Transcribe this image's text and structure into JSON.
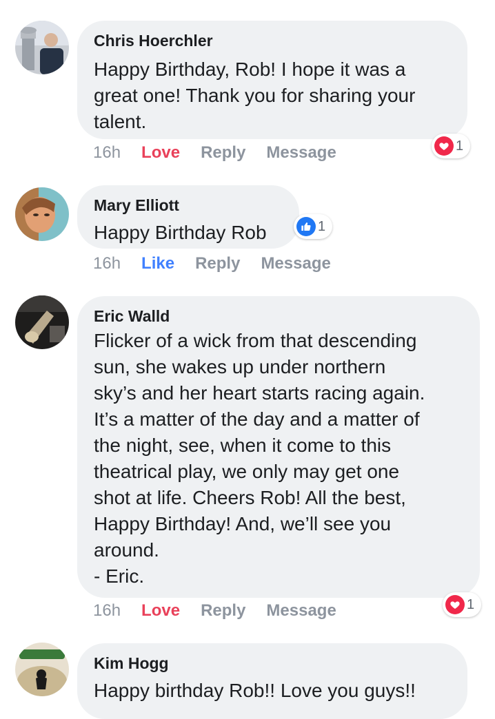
{
  "comments": [
    {
      "author": "Chris Hoerchler",
      "text": "Happy Birthday, Rob! I hope it was a\ngreat one! Thank you for sharing your\ntalent.",
      "time": "16h",
      "reaction_action": "Love",
      "reply": "Reply",
      "message": "Message",
      "reaction": {
        "icon": "heart-icon",
        "count": "1",
        "color": "#f0284a"
      }
    },
    {
      "author": "Mary Elliott",
      "text": "Happy Birthday Rob",
      "time": "16h",
      "reaction_action": "Like",
      "reply": "Reply",
      "message": "Message",
      "reaction": {
        "icon": "thumbs-up-icon",
        "count": "1",
        "color": "#2078f4"
      }
    },
    {
      "author": "Eric Walld",
      "text": "Flicker of a wick from that descending\nsun, she wakes up under northern\nsky’s and her heart starts racing again.\nIt’s a matter of the day and a matter of\nthe night, see, when it come to this\ntheatrical play, we only may get one\nshot at life.  Cheers Rob!  All the best,\nHappy Birthday!  And, we’ll see you\naround.\n- Eric.",
      "time": "16h",
      "reaction_action": "Love",
      "reply": "Reply",
      "message": "Message",
      "reaction": {
        "icon": "heart-icon",
        "count": "1",
        "color": "#f0284a"
      }
    },
    {
      "author": "Kim Hogg",
      "text": "Happy birthday Rob!! Love you guys!!"
    }
  ],
  "colors": {
    "bubble": "#eff1f3",
    "love": "#e9415a",
    "like": "#4080ff",
    "meta": "#8d949e"
  }
}
